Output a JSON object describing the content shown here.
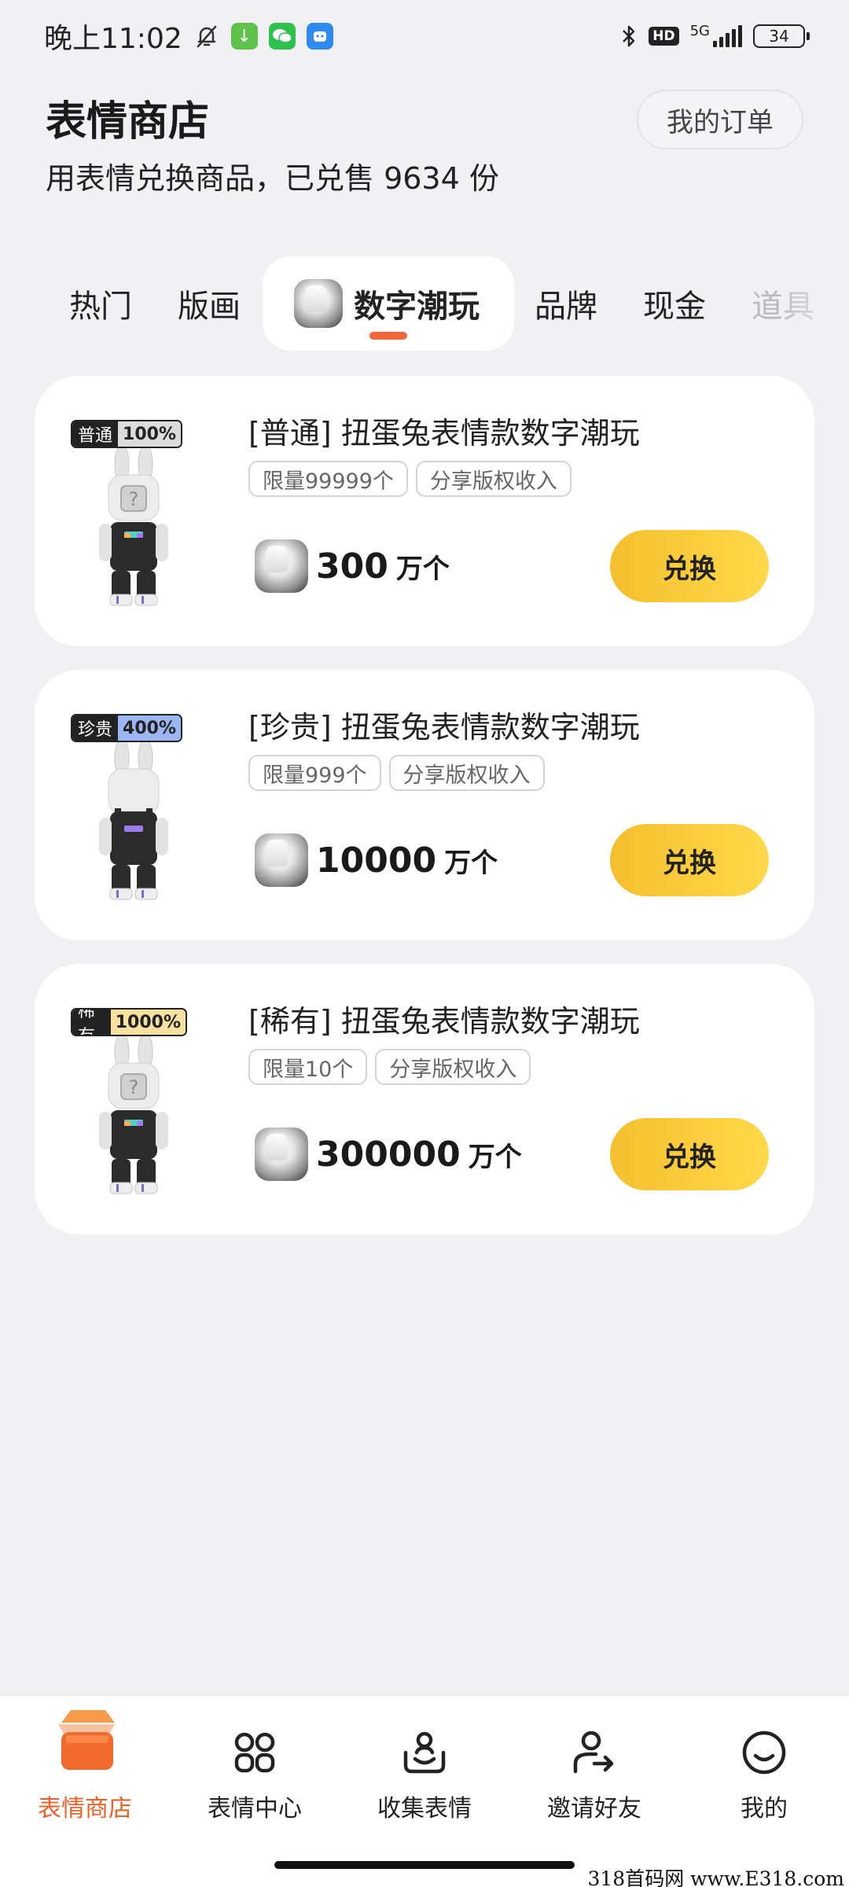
{
  "status_bar": {
    "time": "晚上11:02",
    "network": "5G",
    "hd": "HD",
    "battery": "34"
  },
  "header": {
    "title": "表情商店",
    "subtitle": "用表情兑换商品，已兑售 9634 份",
    "orders_label": "我的订单"
  },
  "tabs": [
    {
      "label": "热门"
    },
    {
      "label": "版画"
    },
    {
      "label": "数字潮玩",
      "active": true,
      "icon": "ice-token-icon"
    },
    {
      "label": "品牌"
    },
    {
      "label": "现金"
    },
    {
      "label": "道具"
    }
  ],
  "products": [
    {
      "rarity": "普通",
      "rarity_pct": "100%",
      "rarity_color": "#dcdcdc",
      "title": "[普通] 扭蛋兔表情款数字潮玩",
      "tags": [
        "限量99999个",
        "分享版权收入"
      ],
      "price": "300",
      "unit": "万个",
      "button": "兑换"
    },
    {
      "rarity": "珍贵",
      "rarity_pct": "400%",
      "rarity_color": "#9bb6f2",
      "title": "[珍贵] 扭蛋兔表情款数字潮玩",
      "tags": [
        "限量999个",
        "分享版权收入"
      ],
      "price": "10000",
      "unit": "万个",
      "button": "兑换"
    },
    {
      "rarity": "稀有",
      "rarity_pct": "1000%",
      "rarity_color": "#f6e1a0",
      "title": "[稀有] 扭蛋兔表情款数字潮玩",
      "tags": [
        "限量10个",
        "分享版权收入"
      ],
      "price": "300000",
      "unit": "万个",
      "button": "兑换"
    }
  ],
  "bottom_nav": [
    {
      "label": "表情商店",
      "icon": "shop-icon",
      "active": true
    },
    {
      "label": "表情中心",
      "icon": "grid-icon"
    },
    {
      "label": "收集表情",
      "icon": "collect-icon"
    },
    {
      "label": "邀请好友",
      "icon": "invite-icon"
    },
    {
      "label": "我的",
      "icon": "profile-icon"
    }
  ],
  "accent_color": "#f05f25",
  "watermark": "318首码网 www.E318.com"
}
